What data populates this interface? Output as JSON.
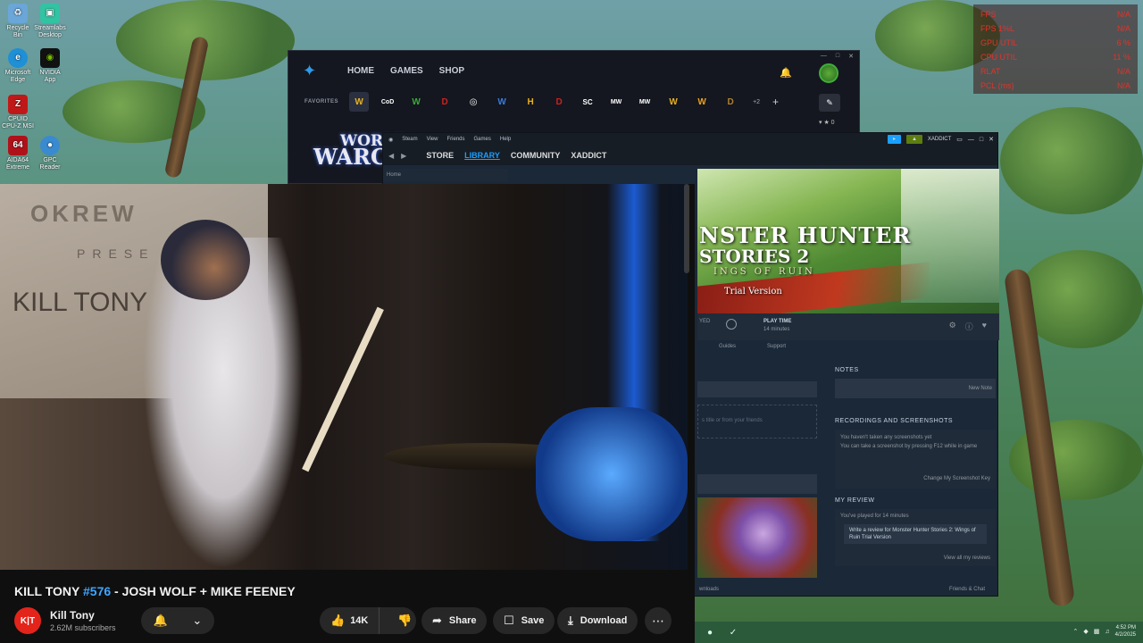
{
  "desktop": {
    "icons": [
      {
        "label": "Recycle Bin",
        "icon": "recycle-bin-icon",
        "glyph": "♻",
        "color": "#6aa6d8"
      },
      {
        "label": "Streamlabs Desktop",
        "icon": "streamlabs-icon",
        "glyph": "▣",
        "color": "#31c3a2"
      },
      {
        "label": "Microsoft Edge",
        "icon": "edge-icon",
        "glyph": "e",
        "color": "#1f8fd6"
      },
      {
        "label": "NVIDIA App",
        "icon": "nvidia-icon",
        "glyph": "◉",
        "color": "#76b900"
      },
      {
        "label": "CPUID CPU-Z MSI",
        "icon": "cpuz-icon",
        "glyph": "Z",
        "color": "#c01818"
      },
      {
        "label": "AIDA64 Extreme",
        "icon": "aida64-icon",
        "glyph": "64",
        "color": "#b0121a"
      },
      {
        "label": "GPC Reader",
        "icon": "globe-icon",
        "glyph": "●",
        "color": "#3a8ad0"
      }
    ]
  },
  "perf_overlay": {
    "rows": [
      {
        "label": "FPS",
        "value": "N/A"
      },
      {
        "label": "FPS 1%L",
        "value": "N/A"
      },
      {
        "label": "GPU UTIL",
        "value": "6 %"
      },
      {
        "label": "CPU UTIL",
        "value": "11 %"
      },
      {
        "label": "RLAT",
        "value": "N/A"
      },
      {
        "label": "PCL (ms)",
        "value": "N/A"
      }
    ],
    "color": "#e0332a"
  },
  "battlenet": {
    "nav": [
      "HOME",
      "GAMES",
      "SHOP"
    ],
    "favorites_label": "FAVORITES",
    "games": [
      {
        "glyph": "W",
        "color": "#e8b021",
        "icon": "wow-icon"
      },
      {
        "glyph": "CoD",
        "color": "#ffffff",
        "icon": "call-of-duty-icon"
      },
      {
        "glyph": "W",
        "color": "#3da83a",
        "icon": "wow-classic-icon"
      },
      {
        "glyph": "D",
        "color": "#d02020",
        "icon": "diablo-icon"
      },
      {
        "glyph": "◎",
        "color": "#ffffff",
        "icon": "overwatch-icon"
      },
      {
        "glyph": "W",
        "color": "#3a7ad8",
        "icon": "warcraft-rumble-icon"
      },
      {
        "glyph": "H",
        "color": "#e8b021",
        "icon": "hearthstone-icon"
      },
      {
        "glyph": "D",
        "color": "#d02020",
        "icon": "diablo-immortal-icon"
      },
      {
        "glyph": "SC",
        "color": "#ffffff",
        "icon": "starcraft-icon"
      },
      {
        "glyph": "MW",
        "color": "#ffffff",
        "icon": "modern-warfare-icon"
      },
      {
        "glyph": "MW",
        "color": "#ffffff",
        "icon": "modern-warfare-2-icon"
      },
      {
        "glyph": "W",
        "color": "#e8b021",
        "icon": "warcraft-icon"
      },
      {
        "glyph": "W",
        "color": "#e8a021",
        "icon": "warcraft-3-icon"
      },
      {
        "glyph": "D",
        "color": "#b08030",
        "icon": "diablo-2-icon"
      }
    ],
    "more_label": "+2",
    "friend_count": "▾ ★ 0",
    "banner_line1": "WORLD",
    "banner_line2": "WARCR"
  },
  "steam": {
    "menu": [
      "Steam",
      "View",
      "Friends",
      "Games",
      "Help"
    ],
    "user": "XADDICT",
    "nav": [
      {
        "label": "STORE",
        "active": false
      },
      {
        "label": "LIBRARY",
        "active": true
      },
      {
        "label": "COMMUNITY",
        "active": false
      },
      {
        "label": "XADDICT",
        "active": false
      }
    ],
    "home": "Home",
    "game": {
      "title_line1": "NSTER HUNTER",
      "title_line2": "STORIES 2",
      "title_line3": "INGS OF RUIN",
      "trial": "Trial Version"
    },
    "play": {
      "played_label": "YED",
      "playtime_label": "PLAY TIME",
      "playtime_value": "14 minutes"
    },
    "tabs": [
      "Guides",
      "Support"
    ],
    "activity_hint": "s title or from your friends",
    "notes": {
      "title": "NOTES",
      "new_note": "New Note"
    },
    "recordings": {
      "title": "RECORDINGS AND SCREENSHOTS",
      "line1": "You haven't taken any screenshots yet",
      "line2": "You can take a screenshot by pressing F12 while in game",
      "change_key": "Change My Screenshot Key"
    },
    "review": {
      "title": "MY REVIEW",
      "played": "You've played for 14 minutes",
      "write": "Write a review for Monster Hunter Stories 2: Wings of Ruin Trial Version",
      "all": "View all my reviews"
    },
    "footer_left": "wnloads",
    "footer_right": "Friends & Chat"
  },
  "youtube": {
    "title_prefix": "KILL TONY ",
    "title_tag": "#576",
    "title_suffix": " - JOSH WOLF + MIKE FEENEY",
    "channel": "Kill Tony",
    "subscribers": "2.62M subscribers",
    "likes": "14K",
    "share": "Share",
    "save": "Save",
    "download": "Download",
    "sign_line1": "OKREW",
    "sign_line2": "PRESE",
    "sign_line3": "KILL TONY"
  },
  "taskbar": {
    "time": "4:52 PM",
    "date": "4/2/2025"
  }
}
